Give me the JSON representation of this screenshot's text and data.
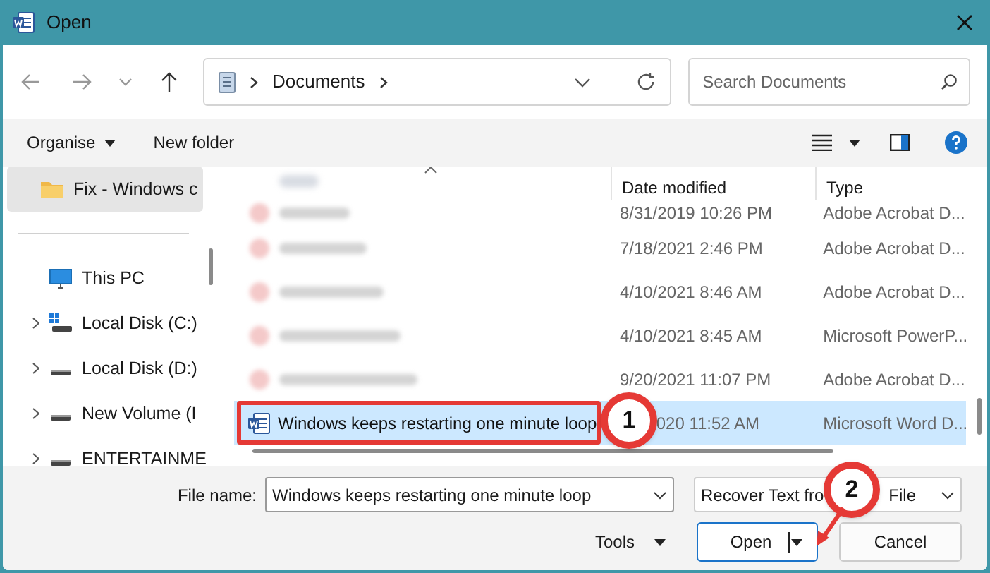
{
  "window": {
    "title": "Open"
  },
  "nav": {
    "path": [
      "Documents"
    ],
    "search_placeholder": "Search Documents"
  },
  "toolbar": {
    "organise": "Organise",
    "new_folder": "New folder"
  },
  "sidebar": {
    "items": [
      {
        "label": "Fix - Windows c",
        "kind": "folder",
        "selected": true,
        "expandable": false
      },
      {
        "label": "This PC",
        "kind": "pc",
        "selected": false,
        "expandable": false
      },
      {
        "label": "Local Disk (C:)",
        "kind": "system-drive",
        "selected": false,
        "expandable": true
      },
      {
        "label": "Local Disk (D:)",
        "kind": "drive",
        "selected": false,
        "expandable": true
      },
      {
        "label": "New Volume (I",
        "kind": "drive",
        "selected": false,
        "expandable": true
      },
      {
        "label": "ENTERTAINME",
        "kind": "drive",
        "selected": false,
        "expandable": true
      }
    ]
  },
  "table": {
    "columns": [
      "Date modified",
      "Type"
    ],
    "rows": [
      {
        "kind": "blurred",
        "name": "",
        "date": "8/31/2019 10:26 PM",
        "type": "Adobe Acrobat D...",
        "selected": false
      },
      {
        "kind": "blurred",
        "name": "",
        "date": "7/18/2021 2:46 PM",
        "type": "Adobe Acrobat D...",
        "selected": false
      },
      {
        "kind": "blurred",
        "name": "",
        "date": "4/10/2021 8:46 AM",
        "type": "Adobe Acrobat D...",
        "selected": false
      },
      {
        "kind": "blurred",
        "name": "",
        "date": "4/10/2021 8:45 AM",
        "type": "Microsoft PowerP...",
        "selected": false
      },
      {
        "kind": "blurred",
        "name": "",
        "date": "9/20/2021 11:07 PM",
        "type": "Adobe Acrobat D...",
        "selected": false
      },
      {
        "kind": "word",
        "name": "Windows keeps restarting one minute loop",
        "date": "020 11:52 AM",
        "type": "Microsoft Word D...",
        "selected": true
      }
    ]
  },
  "bottom": {
    "file_name_label": "File name:",
    "file_name": "Windows keeps restarting one minute loop",
    "filter": [
      "Recover Text fro",
      "File"
    ],
    "tools": "Tools",
    "open": "Open",
    "cancel": "Cancel"
  },
  "annotations": [
    {
      "label": "1"
    },
    {
      "label": "2"
    }
  ]
}
